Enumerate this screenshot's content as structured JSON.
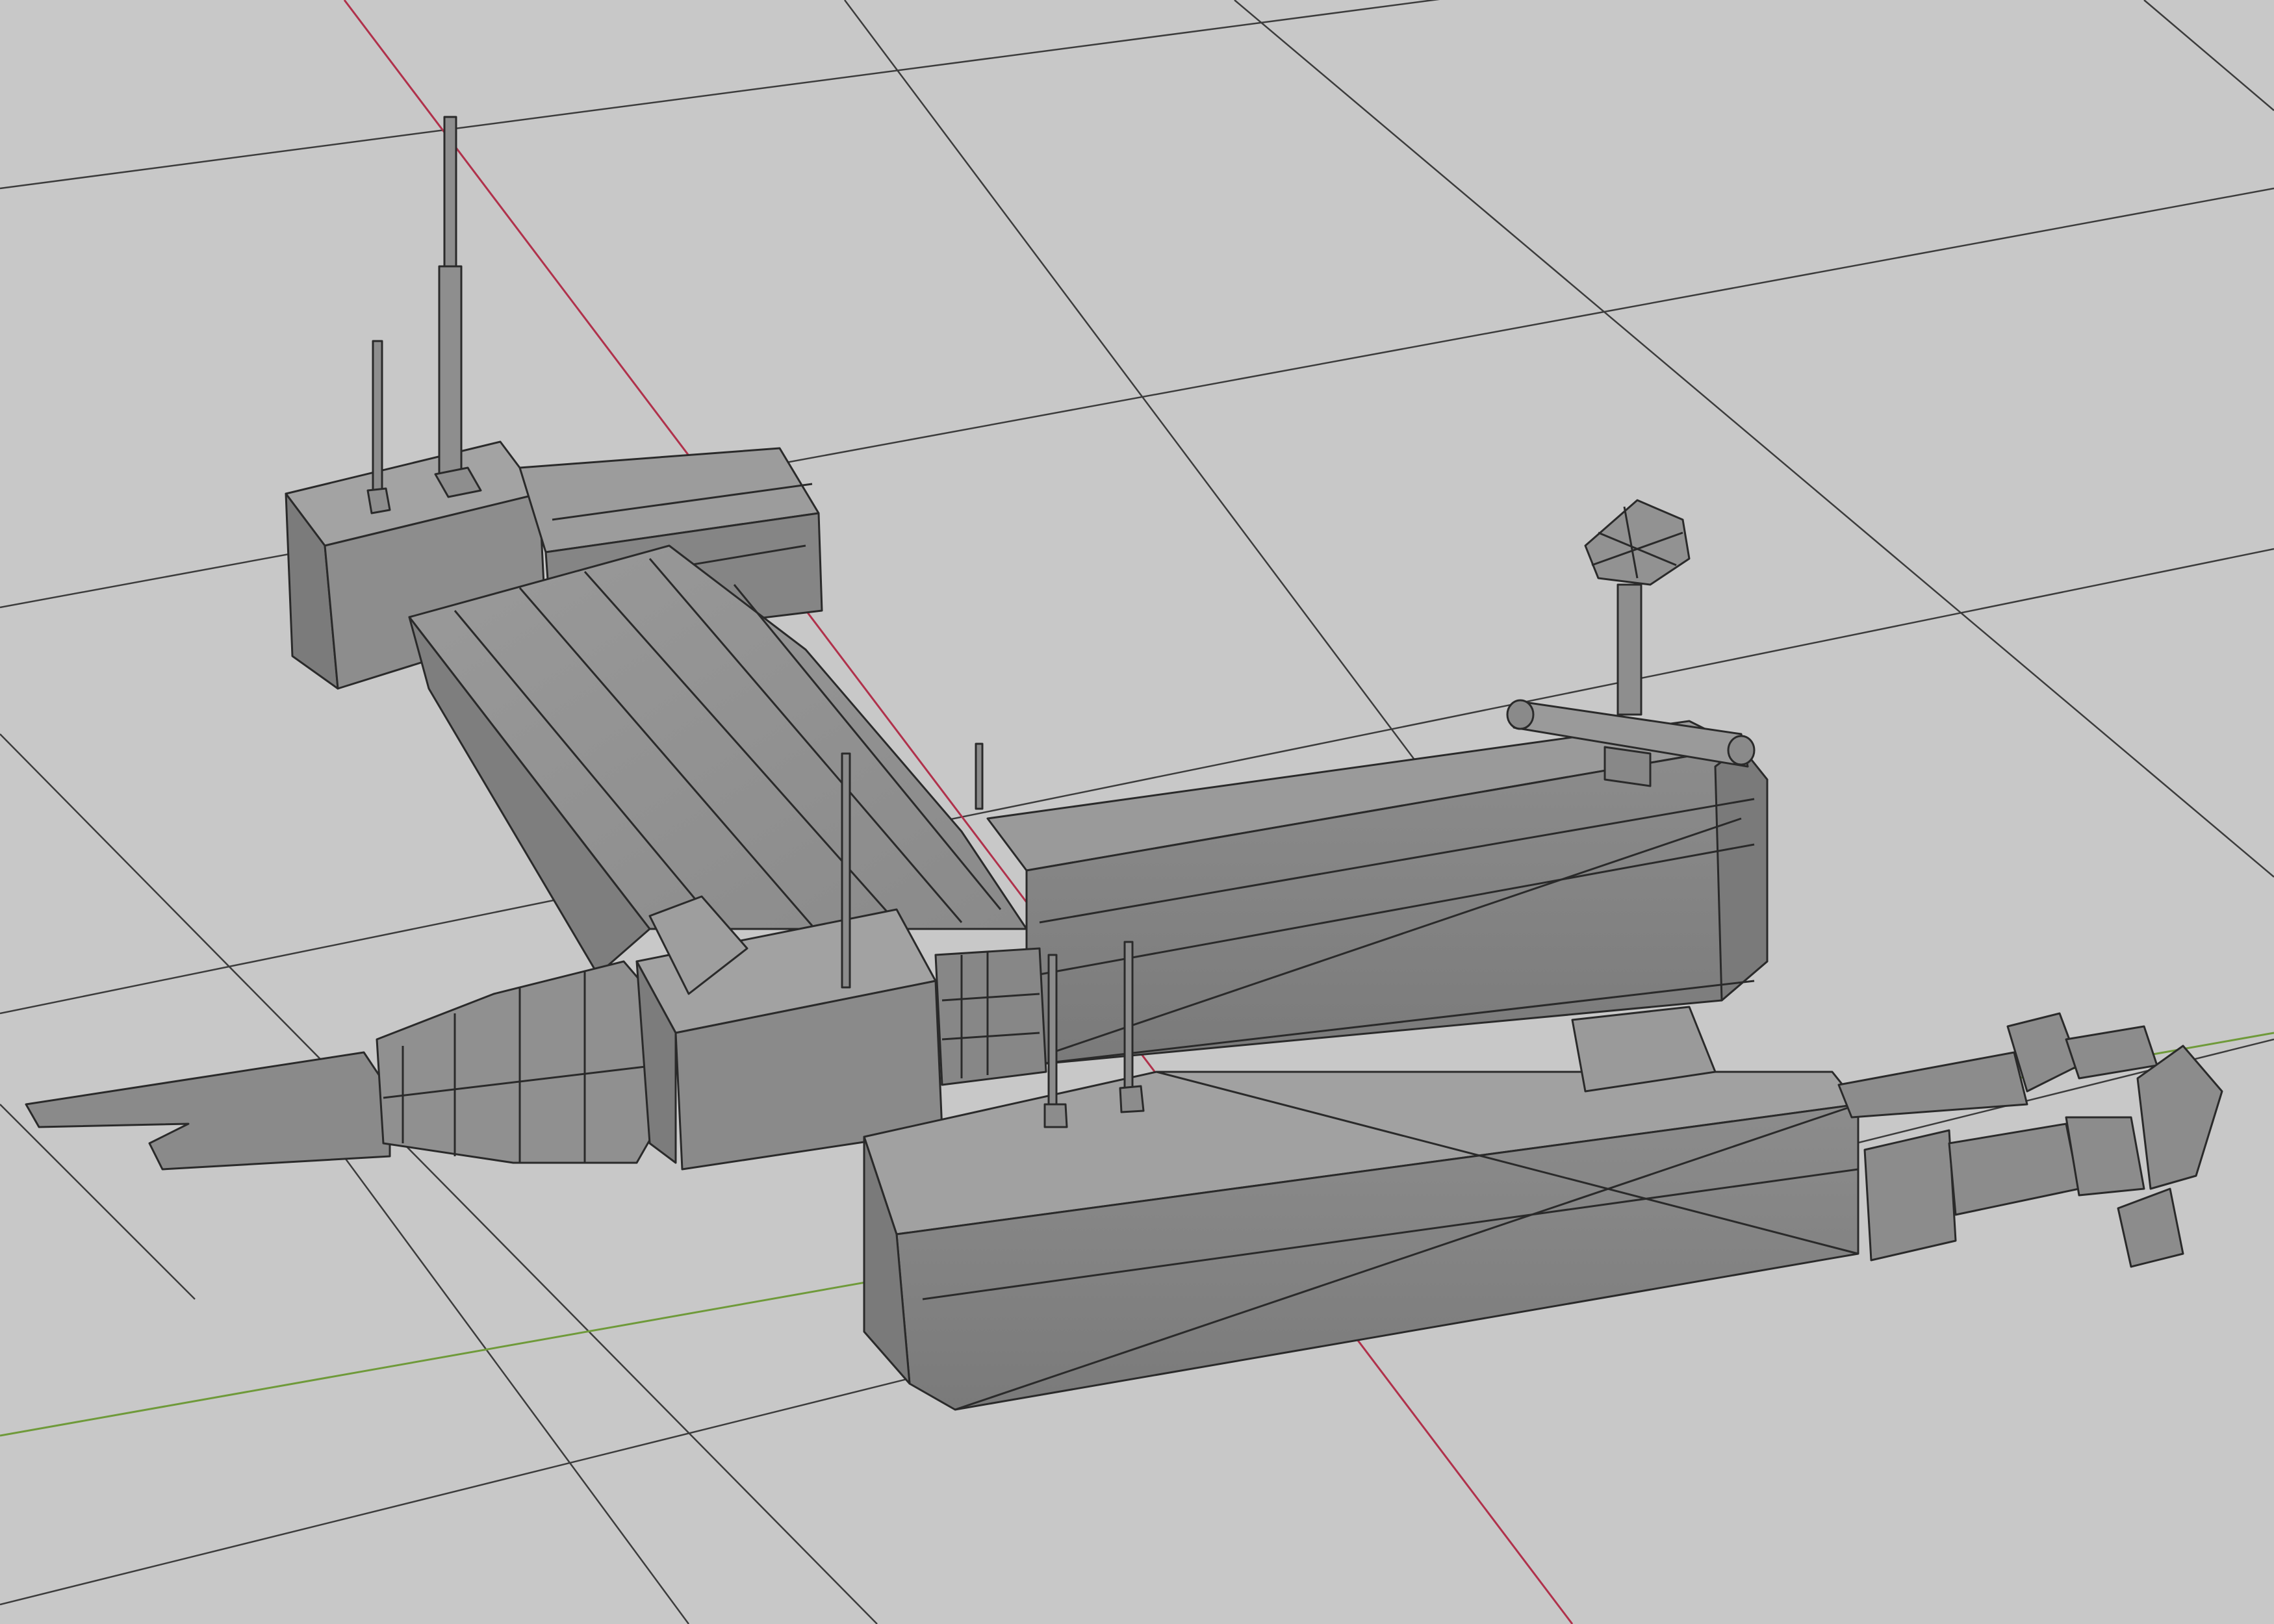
{
  "viewport": {
    "mode": "solid-wireframe",
    "background_color": "#c8c8c8",
    "grid_color": "#3c3c3c",
    "x_axis_color": "#b0314b",
    "y_axis_color": "#6f9a3a",
    "mesh_fill_color": "#8a8a8a",
    "mesh_edge_color": "#2a2a2a"
  },
  "model": {
    "parts": [
      "rear-tower",
      "hull-neck",
      "main-hull",
      "lower-wing",
      "engine-nozzle",
      "bridge-block",
      "antenna-mast",
      "sensor-dish",
      "crossbar",
      "front-claws"
    ]
  }
}
